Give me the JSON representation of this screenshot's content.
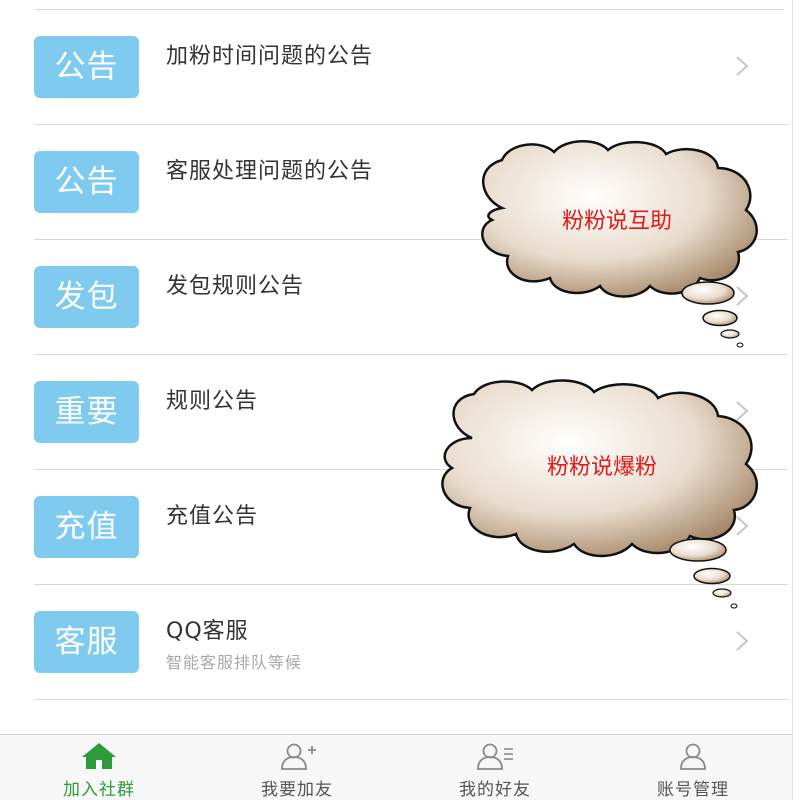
{
  "list": {
    "items": [
      {
        "badge": "公告",
        "title": "加粉时间问题的公告",
        "subtitle": ""
      },
      {
        "badge": "公告",
        "title": "客服处理问题的公告",
        "subtitle": ""
      },
      {
        "badge": "发包",
        "title": "发包规则公告",
        "subtitle": ""
      },
      {
        "badge": "重要",
        "title": "规则公告",
        "subtitle": ""
      },
      {
        "badge": "充值",
        "title": "充值公告",
        "subtitle": ""
      },
      {
        "badge": "客服",
        "title": "QQ客服",
        "subtitle": "智能客服排队等候"
      }
    ]
  },
  "bubbles": {
    "top": "粉粉说互助",
    "bottom": "粉粉说爆粉"
  },
  "tabbar": {
    "tabs": [
      {
        "label": "加入社群",
        "icon": "home-icon",
        "active": true
      },
      {
        "label": "我要加友",
        "icon": "add-friend-icon",
        "active": false
      },
      {
        "label": "我的好友",
        "icon": "friend-list-icon",
        "active": false
      },
      {
        "label": "账号管理",
        "icon": "account-icon",
        "active": false
      }
    ]
  },
  "colors": {
    "badge_bg": "#7ecbef",
    "active_tab": "#2e9b3a",
    "bubble_text": "#e11b1b"
  }
}
